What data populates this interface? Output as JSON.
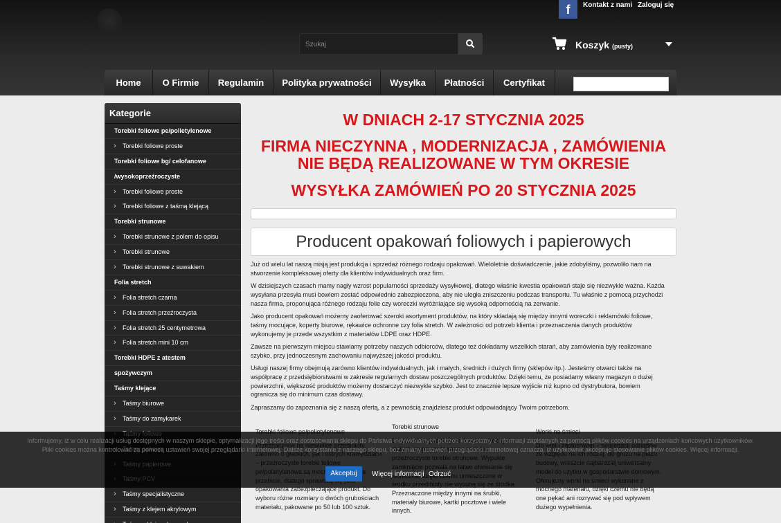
{
  "header": {
    "facebook_label": "f",
    "contact_link": "Kontakt z nami",
    "login_link": "Zaloguj się",
    "search_placeholder": "Szukaj",
    "cart_label": "Koszyk",
    "cart_status": "(pusty)"
  },
  "nav": {
    "items": [
      "Home",
      "O Firmie",
      "Regulamin",
      "Polityka prywatności",
      "Wysyłka",
      "Płatności",
      "Certyfikat"
    ]
  },
  "sidebar": {
    "title": "Kategorie",
    "items": [
      {
        "label": "Torebki foliowe pe/polietylenowe",
        "type": "parent"
      },
      {
        "label": "Torebki foliowe proste",
        "type": "child"
      },
      {
        "label": "Torebki foliowe bg/ celofanowe",
        "type": "parent"
      },
      {
        "label": "/wysokoprzeźroczyste",
        "type": "parent"
      },
      {
        "label": "Torebki foliowe proste",
        "type": "child"
      },
      {
        "label": "Torebki foliowe z taśmą klejącą",
        "type": "child"
      },
      {
        "label": "Torebki strunowe",
        "type": "parent"
      },
      {
        "label": "Torebki strunowe z polem do opisu",
        "type": "child"
      },
      {
        "label": "Torebki strunowe",
        "type": "child"
      },
      {
        "label": "Torebki strunowe z suwakiem",
        "type": "child"
      },
      {
        "label": "Folia stretch",
        "type": "parent"
      },
      {
        "label": "Folia stretch czarna",
        "type": "child"
      },
      {
        "label": "Folia stretch przeźroczysta",
        "type": "child"
      },
      {
        "label": "Folia stretch 25 centymetrowa",
        "type": "child"
      },
      {
        "label": "Folia stretch mini 10 cm",
        "type": "child"
      },
      {
        "label": "Torebki HDPE z atestem",
        "type": "parent"
      },
      {
        "label": "spożywczym",
        "type": "parent"
      },
      {
        "label": "Taśmy klejące",
        "type": "parent"
      },
      {
        "label": "Taśmy biurowe",
        "type": "child"
      },
      {
        "label": "Taśmy do zamykarek",
        "type": "child"
      },
      {
        "label": "Taśmy foliowe",
        "type": "child"
      },
      {
        "label": "Taśmy pakowe",
        "type": "child"
      },
      {
        "label": "Taśmy papierowe",
        "type": "child"
      },
      {
        "label": "Taśmy PCV",
        "type": "child"
      },
      {
        "label": "Taśmy specjalistyczne",
        "type": "child"
      },
      {
        "label": "Taśmy z klejem akrylowym",
        "type": "child"
      },
      {
        "label": "Taśmy z klejem kauczukowym",
        "type": "child"
      }
    ]
  },
  "notice": {
    "line1": "W DNIACH 2-17 STYCZNIA 2025",
    "line2": "FIRMA NIECZYNNA , MODERNIZACJA , ZAMÓWIENIA NIE BĘDĄ REALIZOWANE W TYM OKRESIE",
    "line3": "WYSYŁKA ZAMÓWIEŃ PO 20 STYCZNIA 2025"
  },
  "content": {
    "heading": "Producent opakowań foliowych i papierowych",
    "paragraphs": [
      "Już od wielu lat naszą misją jest produkcja i sprzedaż różnego rodzaju opakowań. Wieloletnie doświadczenie, jakie zdobyliśmy, pozwoliło nam na stworzenie kompleksowej oferty dla klientów indywidualnych oraz firm.",
      "W dzisiejszych czasach mamy nagły wzrost popularności sprzedaży wysyłkowej, dlatego właśnie kwestia opakowań staje się niezwykle ważna. Każda wysyłana przesyła musi bowiem zostać odpowiednio zabezpieczona, aby nie uległa zniszczeniu podczas transportu. Tu właśnie z pomocą przychodzi nasza firma, proponująca różnego rodzaju folie czy woreczki wyróżniające się wysoką odpornością na zerwanie.",
      "Jako producent opakowań możemy zaoferować szeroki asortyment produktów, na który składają się między innymi woreczki i reklamówki foliowe, taśmy mocujące, koperty biurowe, rękawice ochronne czy folia stretch. W zależności od potrzeb klienta i przeznaczenia danych produktów wykonujemy je przede wszystkim z materiałów LDPE oraz HDPE.",
      "Zawsze na pierwszym miejscu stawiamy potrzeby naszych odbiorców, dlatego też dokładamy wszelkich starań, aby zamówienia były realizowane szybko, przy jednoczesnym zachowaniu najwyższej jakości produktu.",
      "Usługi naszej firmy obejmują zarówno klientów indywidualnych, jak i małych, średnich i dużych firmy (sklepów itp.). Jesteśmy otwarci także na współpracę z przedsiębiorstwami w zakresie regularnych dostaw poszczególnych produktów. Dzięki temu, że posiadamy własny magazyn o dużej powierzchni, większość produktów możemy dostarczyć niezwykle szybko. Jest to znacznie lepsze wyjście niż kupno od dystrybutora, bowiem ogranicza się do minimum czas dostawy.",
      "Zapraszamy do zapoznania się z naszą ofertą, a z pewnością znajdziesz produkt odpowiadający Twoim potrzebom."
    ],
    "columns": [
      {
        "title": "Torebki foliowe pe/polietylenowe",
        "text": "Przeznaczone na niewielkie przedmioty, zarówno o gładkich, jak i ostrych krawędziach – przeźroczyste torebki foliowe pe/polietylenowe są mocne, odporne na przebicie, dlatego sprawdzą się jako opakowania zabezpieczające produkt. Do wyboru różne rozmiary o dwóch grubościach materiału, pakowane po 50 lub 100 sztuk."
      },
      {
        "title": "Torebki strunowe",
        "text": "Do przechowywania przedmiotów drobnych i dużych są przygotowane specjalne przeźroczyste torebki strunowe. Wypukłe zamknięcie pozwala na łatwe otwieranie się woreczka, dzięki czemu umieszczone w środku przedmioty nie wysuną się ze środka. Przeznaczone między innymi na śrubki, materiały biurowe, kartki pocztowe i wiele innych."
      },
      {
        "title": "Worki na śmieci",
        "text": "Do wielu zastosowań – segregacji odpadów ze względu na ich rodzaj, do gruzu na placu budowy, wreszcie najbardziej uniwersalny model do użytku w gospodarstwie domowym. Oferujemy worki na śmieci wykonane z mocnego materiału, dzięki czemu nie będą one pękać ani rozrywać się pod wpływem dużego wypełnienia."
      }
    ]
  },
  "cookie": {
    "line1": "Informujemy, iż w celu realizacji usług dostępnych w naszym sklepie, optymalizacji jego treści oraz dostosowania sklepu do Państwa indywidualnych potrzeb korzystamy z informacji zapisanych za pomocą plików cookies na urządzeniach końcowych użytkowników.",
    "line2": "Pliki cookies można kontrolować za pomocą ustawień swojej przeglądarki internetowej. Dalsze korzystanie z naszego sklepu, bez zmiany ustawień przeglądarki internetowej oznacza, iż użytkownik akceptuje stosowanie plików cookies. Więcej informacji.",
    "accept": "Akceptuj",
    "more": "Więcej informacji",
    "refuse": "Odrzuć"
  },
  "colors": {
    "accent_red": "#d6181d",
    "cookie_button": "#1f6ac1",
    "facebook": "#3b5998"
  }
}
